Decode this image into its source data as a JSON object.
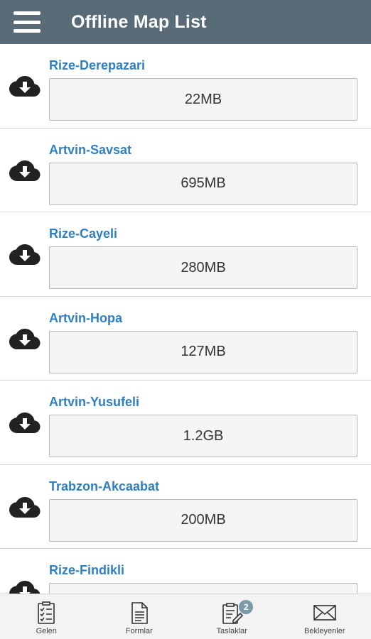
{
  "header": {
    "title": "Offline Map List",
    "menu_icon": "hamburger-icon",
    "background": "#5a6b78"
  },
  "maps": [
    {
      "name": "Rize-Derepazari",
      "size": "22MB"
    },
    {
      "name": "Artvin-Savsat",
      "size": "695MB"
    },
    {
      "name": "Rize-Cayeli",
      "size": "280MB"
    },
    {
      "name": "Artvin-Hopa",
      "size": "127MB"
    },
    {
      "name": "Artvin-Yusufeli",
      "size": "1.2GB"
    },
    {
      "name": "Trabzon-Akcaabat",
      "size": "200MB"
    },
    {
      "name": "Rize-Findikli",
      "size": ""
    }
  ],
  "bottom_nav": [
    {
      "label": "Gelen",
      "icon": "checklist-icon"
    },
    {
      "label": "Formlar",
      "icon": "document-icon"
    },
    {
      "label": "Taslaklar",
      "icon": "draft-edit-icon",
      "badge": "2"
    },
    {
      "label": "Bekleyenler",
      "icon": "envelope-icon"
    }
  ],
  "colors": {
    "accent": "#2f7fc4",
    "appbar": "#5a6b78",
    "badge": "#7a9aa8"
  }
}
